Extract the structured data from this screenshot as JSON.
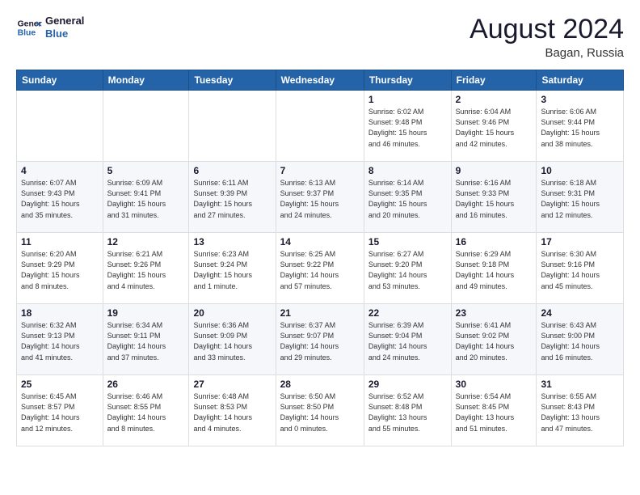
{
  "header": {
    "logo_line1": "General",
    "logo_line2": "Blue",
    "month_year": "August 2024",
    "location": "Bagan, Russia"
  },
  "weekdays": [
    "Sunday",
    "Monday",
    "Tuesday",
    "Wednesday",
    "Thursday",
    "Friday",
    "Saturday"
  ],
  "weeks": [
    [
      {
        "day": "",
        "info": ""
      },
      {
        "day": "",
        "info": ""
      },
      {
        "day": "",
        "info": ""
      },
      {
        "day": "",
        "info": ""
      },
      {
        "day": "1",
        "info": "Sunrise: 6:02 AM\nSunset: 9:48 PM\nDaylight: 15 hours\nand 46 minutes."
      },
      {
        "day": "2",
        "info": "Sunrise: 6:04 AM\nSunset: 9:46 PM\nDaylight: 15 hours\nand 42 minutes."
      },
      {
        "day": "3",
        "info": "Sunrise: 6:06 AM\nSunset: 9:44 PM\nDaylight: 15 hours\nand 38 minutes."
      }
    ],
    [
      {
        "day": "4",
        "info": "Sunrise: 6:07 AM\nSunset: 9:43 PM\nDaylight: 15 hours\nand 35 minutes."
      },
      {
        "day": "5",
        "info": "Sunrise: 6:09 AM\nSunset: 9:41 PM\nDaylight: 15 hours\nand 31 minutes."
      },
      {
        "day": "6",
        "info": "Sunrise: 6:11 AM\nSunset: 9:39 PM\nDaylight: 15 hours\nand 27 minutes."
      },
      {
        "day": "7",
        "info": "Sunrise: 6:13 AM\nSunset: 9:37 PM\nDaylight: 15 hours\nand 24 minutes."
      },
      {
        "day": "8",
        "info": "Sunrise: 6:14 AM\nSunset: 9:35 PM\nDaylight: 15 hours\nand 20 minutes."
      },
      {
        "day": "9",
        "info": "Sunrise: 6:16 AM\nSunset: 9:33 PM\nDaylight: 15 hours\nand 16 minutes."
      },
      {
        "day": "10",
        "info": "Sunrise: 6:18 AM\nSunset: 9:31 PM\nDaylight: 15 hours\nand 12 minutes."
      }
    ],
    [
      {
        "day": "11",
        "info": "Sunrise: 6:20 AM\nSunset: 9:29 PM\nDaylight: 15 hours\nand 8 minutes."
      },
      {
        "day": "12",
        "info": "Sunrise: 6:21 AM\nSunset: 9:26 PM\nDaylight: 15 hours\nand 4 minutes."
      },
      {
        "day": "13",
        "info": "Sunrise: 6:23 AM\nSunset: 9:24 PM\nDaylight: 15 hours\nand 1 minute."
      },
      {
        "day": "14",
        "info": "Sunrise: 6:25 AM\nSunset: 9:22 PM\nDaylight: 14 hours\nand 57 minutes."
      },
      {
        "day": "15",
        "info": "Sunrise: 6:27 AM\nSunset: 9:20 PM\nDaylight: 14 hours\nand 53 minutes."
      },
      {
        "day": "16",
        "info": "Sunrise: 6:29 AM\nSunset: 9:18 PM\nDaylight: 14 hours\nand 49 minutes."
      },
      {
        "day": "17",
        "info": "Sunrise: 6:30 AM\nSunset: 9:16 PM\nDaylight: 14 hours\nand 45 minutes."
      }
    ],
    [
      {
        "day": "18",
        "info": "Sunrise: 6:32 AM\nSunset: 9:13 PM\nDaylight: 14 hours\nand 41 minutes."
      },
      {
        "day": "19",
        "info": "Sunrise: 6:34 AM\nSunset: 9:11 PM\nDaylight: 14 hours\nand 37 minutes."
      },
      {
        "day": "20",
        "info": "Sunrise: 6:36 AM\nSunset: 9:09 PM\nDaylight: 14 hours\nand 33 minutes."
      },
      {
        "day": "21",
        "info": "Sunrise: 6:37 AM\nSunset: 9:07 PM\nDaylight: 14 hours\nand 29 minutes."
      },
      {
        "day": "22",
        "info": "Sunrise: 6:39 AM\nSunset: 9:04 PM\nDaylight: 14 hours\nand 24 minutes."
      },
      {
        "day": "23",
        "info": "Sunrise: 6:41 AM\nSunset: 9:02 PM\nDaylight: 14 hours\nand 20 minutes."
      },
      {
        "day": "24",
        "info": "Sunrise: 6:43 AM\nSunset: 9:00 PM\nDaylight: 14 hours\nand 16 minutes."
      }
    ],
    [
      {
        "day": "25",
        "info": "Sunrise: 6:45 AM\nSunset: 8:57 PM\nDaylight: 14 hours\nand 12 minutes."
      },
      {
        "day": "26",
        "info": "Sunrise: 6:46 AM\nSunset: 8:55 PM\nDaylight: 14 hours\nand 8 minutes."
      },
      {
        "day": "27",
        "info": "Sunrise: 6:48 AM\nSunset: 8:53 PM\nDaylight: 14 hours\nand 4 minutes."
      },
      {
        "day": "28",
        "info": "Sunrise: 6:50 AM\nSunset: 8:50 PM\nDaylight: 14 hours\nand 0 minutes."
      },
      {
        "day": "29",
        "info": "Sunrise: 6:52 AM\nSunset: 8:48 PM\nDaylight: 13 hours\nand 55 minutes."
      },
      {
        "day": "30",
        "info": "Sunrise: 6:54 AM\nSunset: 8:45 PM\nDaylight: 13 hours\nand 51 minutes."
      },
      {
        "day": "31",
        "info": "Sunrise: 6:55 AM\nSunset: 8:43 PM\nDaylight: 13 hours\nand 47 minutes."
      }
    ]
  ]
}
